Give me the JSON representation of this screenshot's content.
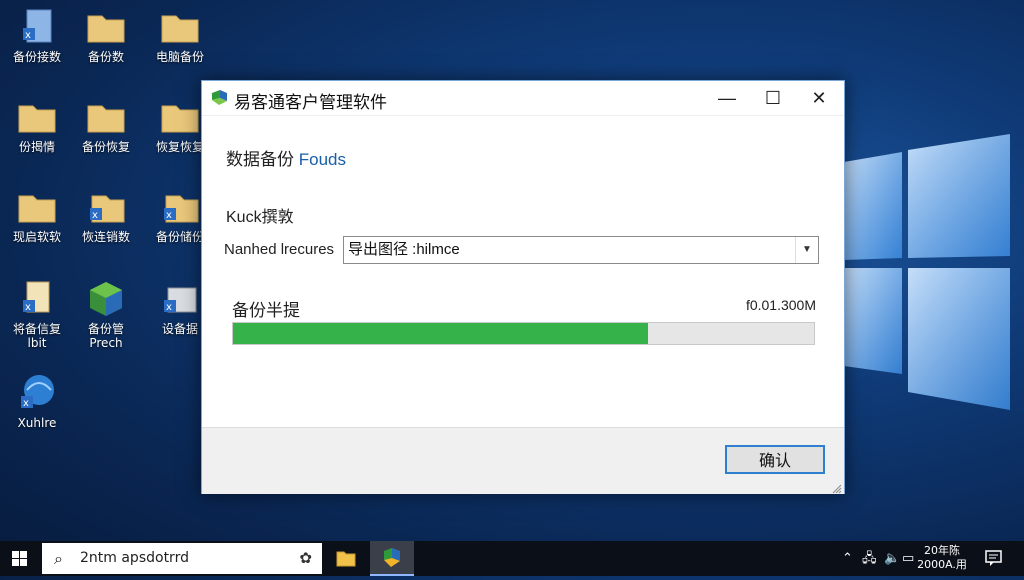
{
  "desktop": {
    "icons": [
      {
        "label": "备份接数"
      },
      {
        "label": "备份数"
      },
      {
        "label": "电脑备份"
      },
      {
        "label": "份揭情"
      },
      {
        "label": "备份恢复"
      },
      {
        "label": "恢复恢复"
      },
      {
        "label": "现启软软"
      },
      {
        "label": "恢连销数"
      },
      {
        "label": "备份储份"
      },
      {
        "label": "将备信复",
        "label2": "lbit"
      },
      {
        "label": "备份管",
        "label2": "Prech"
      },
      {
        "label": "设备据"
      },
      {
        "label": "Xuhlre"
      }
    ]
  },
  "dialog": {
    "title": "易客通客户管理软件",
    "heading_cn": "数据备份 ",
    "heading_accent": "Fouds",
    "section_label": "Kuck撰敦",
    "field_label": "Nanhed lrecures",
    "select_value": "导出图径 :hilmce",
    "progress_title": "备份半提",
    "progress_size": "f0.01.300M",
    "progress_fraction": 0.715,
    "ok_label": "确认",
    "controls": {
      "minimize": "—",
      "maximize": "☐",
      "close": "✕"
    }
  },
  "taskbar": {
    "search_text": "2ntm apsdotrrd",
    "clock_line1": "20年陈",
    "clock_line2": "2000A.用",
    "colors": {
      "progress": "#35b24a",
      "accent": "#1a5ea8",
      "taskbar": "#0b0f18"
    }
  }
}
